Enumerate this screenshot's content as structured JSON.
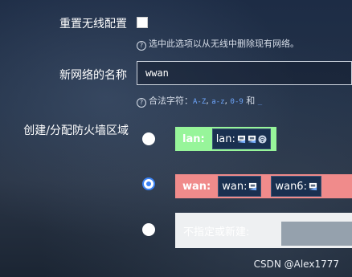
{
  "reset_wireless": {
    "label": "重置无线配置",
    "hint_icon": "question-circle-icon",
    "hint": "选中此选项以从无线中删除现有网络。"
  },
  "network_name": {
    "label": "新网络的名称",
    "value": "wwan",
    "hint_icon": "question-circle-icon",
    "hint_prefix": "合法字符：",
    "hint_chars_1": "A-Z",
    "hint_sep_1": ", ",
    "hint_chars_2": "a-z",
    "hint_sep_2": ", ",
    "hint_chars_3": "0-9",
    "hint_and": " 和 ",
    "hint_chars_4": "_"
  },
  "firewall_zone": {
    "label": "创建/分配防火墙区域",
    "options": [
      {
        "zone": "lan:",
        "interfaces": [
          {
            "name": "lan:",
            "icons": [
              "ethernet-port-icon",
              "ethernet-port-icon",
              "wireless-icon"
            ]
          }
        ],
        "selected": false,
        "color": "#97f59a"
      },
      {
        "zone": "wan:",
        "interfaces": [
          {
            "name": "wan:",
            "icons": [
              "ethernet-port-icon"
            ]
          },
          {
            "name": "wan6:",
            "icons": [
              "ethernet-port-icon"
            ]
          }
        ],
        "selected": true,
        "color": "#f08b8b"
      },
      {
        "zone": "不指定或新建:",
        "selected": false,
        "color": "#eef0f2"
      }
    ]
  },
  "watermark": "CSDN @Alex1777"
}
